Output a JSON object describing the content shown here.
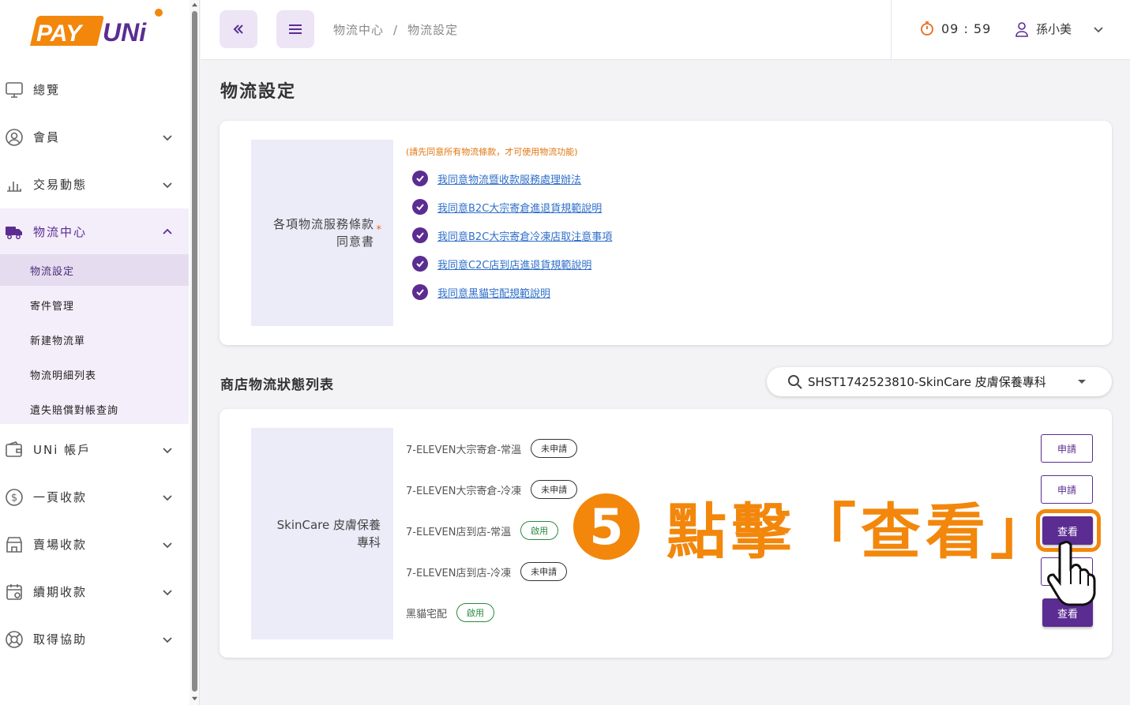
{
  "brand": {
    "name": "PAYUNi",
    "accent": "#5b2c91",
    "orange": "#f2870c"
  },
  "sidebar": {
    "items": [
      {
        "label": "總覽",
        "icon": "monitor-icon"
      },
      {
        "label": "會員",
        "icon": "user-circle-icon"
      },
      {
        "label": "交易動態",
        "icon": "bar-chart-icon"
      },
      {
        "label": "物流中心",
        "icon": "truck-icon"
      },
      {
        "label": "UNi 帳戶",
        "icon": "wallet-icon"
      },
      {
        "label": "一頁收款",
        "icon": "dollar-circle-icon"
      },
      {
        "label": "賣場收款",
        "icon": "store-icon"
      },
      {
        "label": "續期收款",
        "icon": "calendar-icon"
      },
      {
        "label": "取得協助",
        "icon": "lifebuoy-icon"
      }
    ],
    "sub_items": [
      "物流設定",
      "寄件管理",
      "新建物流單",
      "物流明細列表",
      "遺失賠償對帳查詢"
    ]
  },
  "topbar": {
    "breadcrumb": [
      "物流中心",
      "物流設定"
    ],
    "breadcrumb_sep": "/",
    "timer": "09 : 59",
    "user": "孫小美"
  },
  "page": {
    "title": "物流設定"
  },
  "terms": {
    "label_line1": "各項物流服務條款",
    "label_line2": "同意書",
    "required_mark": "*",
    "note": "(請先同意所有物流條款，才可使用物流功能)",
    "links": [
      "我同意物流暨收款服務處理辦法",
      "我同意B2C大宗寄倉進退貨規範說明",
      "我同意B2C大宗寄倉冷凍店取注意事項",
      "我同意C2C店到店進退貨規範說明",
      "我同意黑貓宅配規範說明"
    ]
  },
  "store_list": {
    "title": "商店物流狀態列表",
    "selected_store": "SHST1742523810-SkinCare 皮膚保養專科",
    "store_label_line1": "SkinCare 皮膚保養",
    "store_label_line2": "專科",
    "services": [
      {
        "name": "7-ELEVEN大宗寄倉-常溫",
        "status": "未申請",
        "action": "申請"
      },
      {
        "name": "7-ELEVEN大宗寄倉-冷凍",
        "status": "未申請",
        "action": "申請"
      },
      {
        "name": "7-ELEVEN店到店-常溫",
        "status": "啟用",
        "action": "查看"
      },
      {
        "name": "7-ELEVEN店到店-冷凍",
        "status": "未申請",
        "action": "申請"
      },
      {
        "name": "黑貓宅配",
        "status": "啟用",
        "action": "查看"
      }
    ]
  },
  "annotation": {
    "number": "5",
    "text": "點擊「查看」"
  }
}
